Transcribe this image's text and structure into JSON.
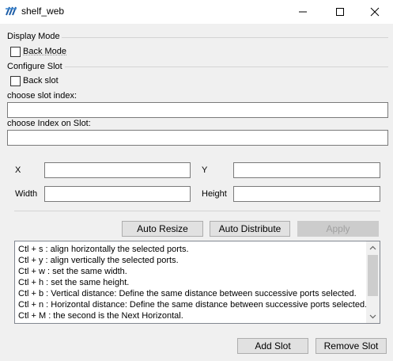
{
  "window": {
    "title": "shelf_web",
    "minimize_glyph": "minimize-icon",
    "maximize_glyph": "maximize-icon",
    "close_glyph": "close-icon"
  },
  "display_mode": {
    "heading": "Display Mode",
    "back_mode_label": "Back Mode",
    "back_mode_checked": false
  },
  "configure_slot": {
    "heading": "Configure Slot",
    "back_slot_label": "Back slot",
    "back_slot_checked": false,
    "slot_index_label": "choose slot index:",
    "slot_index_value": "",
    "index_on_slot_label": "choose Index on Slot:",
    "index_on_slot_value": ""
  },
  "geometry": {
    "x_label": "X",
    "y_label": "Y",
    "width_label": "Width",
    "height_label": "Height",
    "x_value": "",
    "y_value": "",
    "width_value": "",
    "height_value": ""
  },
  "actions": {
    "auto_resize": "Auto Resize",
    "auto_distribute": "Auto Distribute",
    "apply": "Apply",
    "apply_enabled": false
  },
  "help_lines": [
    "Ctl + s : align horizontally the selected ports.",
    "Ctl + y : align vertically the selected ports.",
    "Ctl + w : set the same width.",
    "Ctl + h : set the same height.",
    "Ctl + b : Vertical distance: Define the same distance between successive ports selected.",
    "Ctl + n : Horizontal distance: Define the same distance between successive ports selected.",
    "Ctl + M : the second is the Next Horizontal."
  ],
  "footer": {
    "add_slot": "Add Slot",
    "remove_slot": "Remove Slot"
  }
}
